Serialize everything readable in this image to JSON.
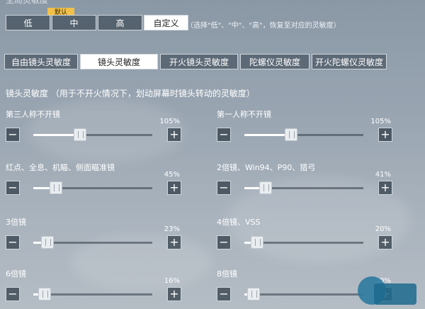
{
  "header": {
    "title": "全局灵敏度"
  },
  "presets": {
    "items": [
      "低",
      "中",
      "高",
      "自定义"
    ],
    "active_index": 3,
    "default_badge": "默认",
    "hint": "（选择\"低\"、\"中\"、\"高\"，恢复至对应的灵敏度）"
  },
  "tabs": {
    "items": [
      "自由镜头灵敏度",
      "镜头灵敏度",
      "开火镜头灵敏度",
      "陀螺仪灵敏度",
      "开火陀螺仪灵敏度"
    ],
    "active_index": 1
  },
  "section": {
    "label": "镜头灵敏度 （用于不开火情况下，划动屏幕时镜头转动的灵敏度）"
  },
  "sliders": [
    {
      "label": "第三人称不开镜",
      "value_text": "105%",
      "value": 105,
      "max": 300
    },
    {
      "label": "第一人称不开镜",
      "value_text": "105%",
      "value": 105,
      "max": 300
    },
    {
      "label": "红点、全息、机瞄、侧面瞄准镜",
      "value_text": "45%",
      "value": 45,
      "max": 300
    },
    {
      "label": "2倍镜、Win94、P90、猎弓",
      "value_text": "41%",
      "value": 41,
      "max": 300
    },
    {
      "label": "3倍镜",
      "value_text": "23%",
      "value": 23,
      "max": 300
    },
    {
      "label": "4倍镜、VSS",
      "value_text": "20%",
      "value": 20,
      "max": 300
    },
    {
      "label": "6倍镜",
      "value_text": "16%",
      "value": 16,
      "max": 300
    },
    {
      "label": "8倍镜",
      "value_text": "10%",
      "value": 10,
      "max": 300
    }
  ],
  "buttons": {
    "minus": "−",
    "plus": "+"
  },
  "colors": {
    "accent_badge": "#f0c04a",
    "active_bg": "#ffffff"
  }
}
